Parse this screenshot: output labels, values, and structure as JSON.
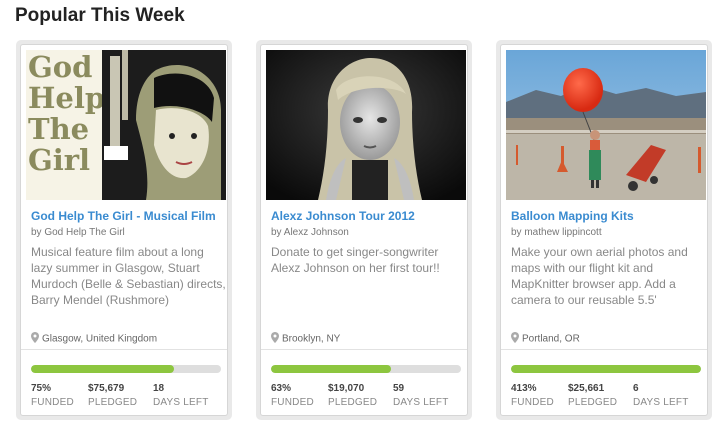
{
  "section": {
    "title": "Popular This Week"
  },
  "projects": [
    {
      "title": "God Help The Girl - Musical Film",
      "byline": "by God Help The Girl",
      "blurb": "Musical feature film about a long lazy summer in Glasgow, Stuart Murdoch (Belle & Sebastian) directs, Barry Mendel (Rushmore)",
      "location": "Glasgow, United Kingdom",
      "funded_pct": 0.75,
      "stats": [
        {
          "value": "75%",
          "label": "FUNDED"
        },
        {
          "value": "$75,679",
          "label": "PLEDGED"
        },
        {
          "value": "18",
          "label": "DAYS LEFT"
        }
      ],
      "image": {
        "kind": "illustration",
        "lettering": [
          "God",
          "Help",
          "The",
          "Girl"
        ]
      }
    },
    {
      "title": "Alexz Johnson Tour 2012",
      "byline": "by Alexz Johnson",
      "blurb": "Donate to get singer-songwriter Alexz Johnson on her first tour!!",
      "location": "Brooklyn, NY",
      "funded_pct": 0.63,
      "stats": [
        {
          "value": "63%",
          "label": "FUNDED"
        },
        {
          "value": "$19,070",
          "label": "PLEDGED"
        },
        {
          "value": "59",
          "label": "DAYS LEFT"
        }
      ],
      "image": {
        "kind": "portrait-photo"
      }
    },
    {
      "title": "Balloon Mapping Kits",
      "byline": "by mathew lippincott",
      "blurb": "Make your own aerial photos and maps with our flight kit and MapKnitter browser app. Add a camera to our reusable 5.5'",
      "location": "Portland, OR",
      "funded_pct": 1.0,
      "stats": [
        {
          "value": "413%",
          "label": "FUNDED"
        },
        {
          "value": "$25,661",
          "label": "PLEDGED"
        },
        {
          "value": "6",
          "label": "DAYS LEFT"
        }
      ],
      "image": {
        "kind": "balloon-photo"
      }
    }
  ],
  "colors": {
    "link": "#3a8bd0",
    "progress": "#8dc63f",
    "progress_track": "#dedede"
  }
}
